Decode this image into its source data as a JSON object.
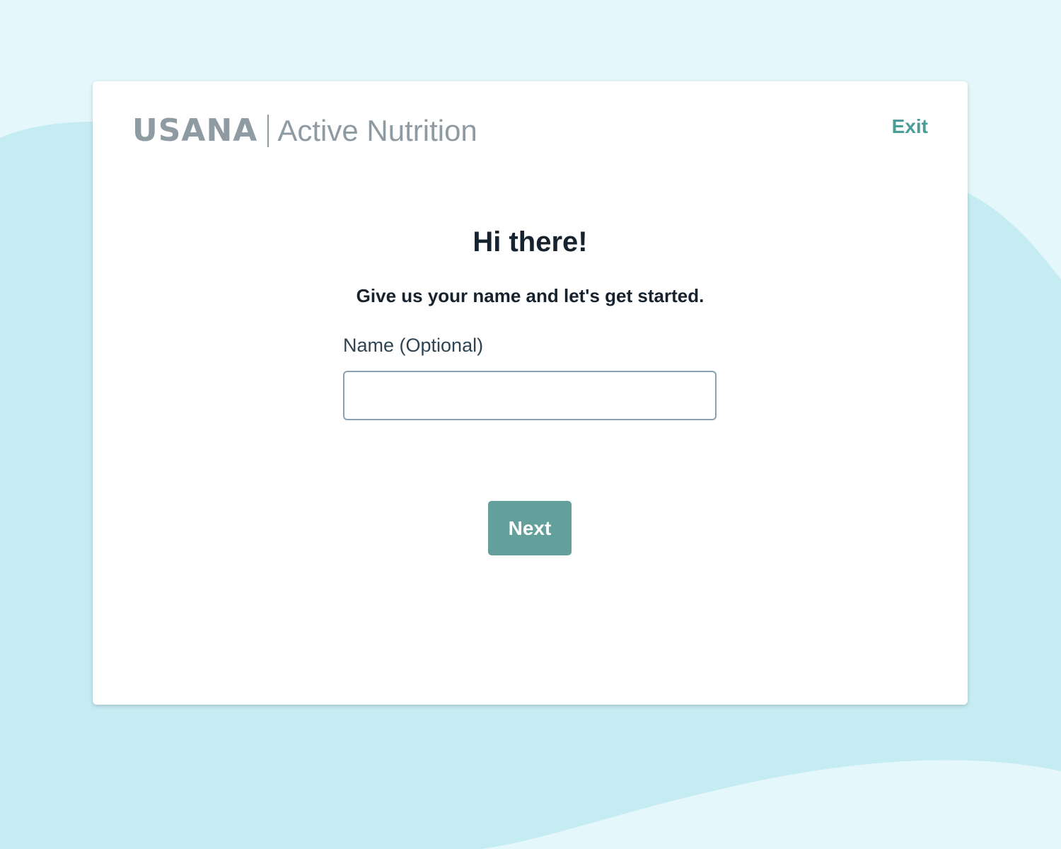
{
  "header": {
    "brand_logo": "USANA",
    "brand_product": "Active Nutrition",
    "exit_label": "Exit"
  },
  "main": {
    "title": "Hi there!",
    "subtitle": "Give us your name and let's get started.",
    "name_label": "Name (Optional)",
    "name_value": "",
    "next_label": "Next"
  },
  "colors": {
    "page_background": "#e4f7fb",
    "wave": "#c6ecf3",
    "accent": "#4a9e98",
    "button": "#63a09c",
    "text_dark": "#16232e",
    "logo_gray": "#8e9ba3"
  }
}
